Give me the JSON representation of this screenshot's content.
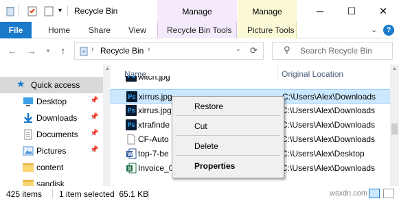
{
  "window": {
    "title": "Recycle Bin",
    "manage_tab_1": "Manage",
    "manage_tab_2": "Manage",
    "minimize": "─",
    "maximize": "☐",
    "close": "✕"
  },
  "ribbon": {
    "tabs": [
      "File",
      "Home",
      "Share",
      "View",
      "Recycle Bin Tools",
      "Picture Tools"
    ],
    "expand_icon": "chevron-down-icon",
    "help_icon": "help-icon"
  },
  "address": {
    "path": "Recycle Bin",
    "search_placeholder": "Search Recycle Bin"
  },
  "nav": {
    "items": [
      {
        "label": "Quick access",
        "icon": "star-icon",
        "pinned": false
      },
      {
        "label": "Desktop",
        "icon": "desktop-icon",
        "pinned": true
      },
      {
        "label": "Downloads",
        "icon": "download-icon",
        "pinned": true
      },
      {
        "label": "Documents",
        "icon": "documents-icon",
        "pinned": true
      },
      {
        "label": "Pictures",
        "icon": "pictures-icon",
        "pinned": true
      },
      {
        "label": "content",
        "icon": "folder-icon",
        "pinned": false
      },
      {
        "label": "sandisk",
        "icon": "folder-icon",
        "pinned": false
      }
    ]
  },
  "list": {
    "columns": [
      "Name",
      "Original Location"
    ],
    "rows": [
      {
        "name": "witch.jpg",
        "location": "",
        "icon": "photoshop-icon"
      },
      {
        "name": "xirrus.jpg",
        "location": "C:\\Users\\Alex\\Downloads",
        "icon": "photoshop-icon",
        "selected": true
      },
      {
        "name": "xirrus.jpg",
        "location": "C:\\Users\\Alex\\Downloads",
        "icon": "photoshop-icon"
      },
      {
        "name": "xtrafinde",
        "location": "C:\\Users\\Alex\\Downloads",
        "icon": "photoshop-icon"
      },
      {
        "name": "CF-Auto",
        "location": "C:\\Users\\Alex\\Downloads",
        "icon": "file-icon"
      },
      {
        "name": "top-7-be",
        "location": "C:\\Users\\Alex\\Desktop",
        "icon": "word-icon"
      },
      {
        "name": "Invoice_0",
        "location": "C:\\Users\\Alex\\Downloads",
        "icon": "excel-icon"
      }
    ]
  },
  "context_menu": {
    "items": [
      "Restore",
      "Cut",
      "Delete",
      "Properties"
    ]
  },
  "status": {
    "item_count": "425 items",
    "selection": "1 item selected  65.1 KB"
  },
  "watermark": "wsxdn.com",
  "colors": {
    "accent": "#1979ca",
    "selection": "#cce8ff",
    "manage_purple": "#f4eafc",
    "manage_yellow": "#fbf8d6"
  }
}
